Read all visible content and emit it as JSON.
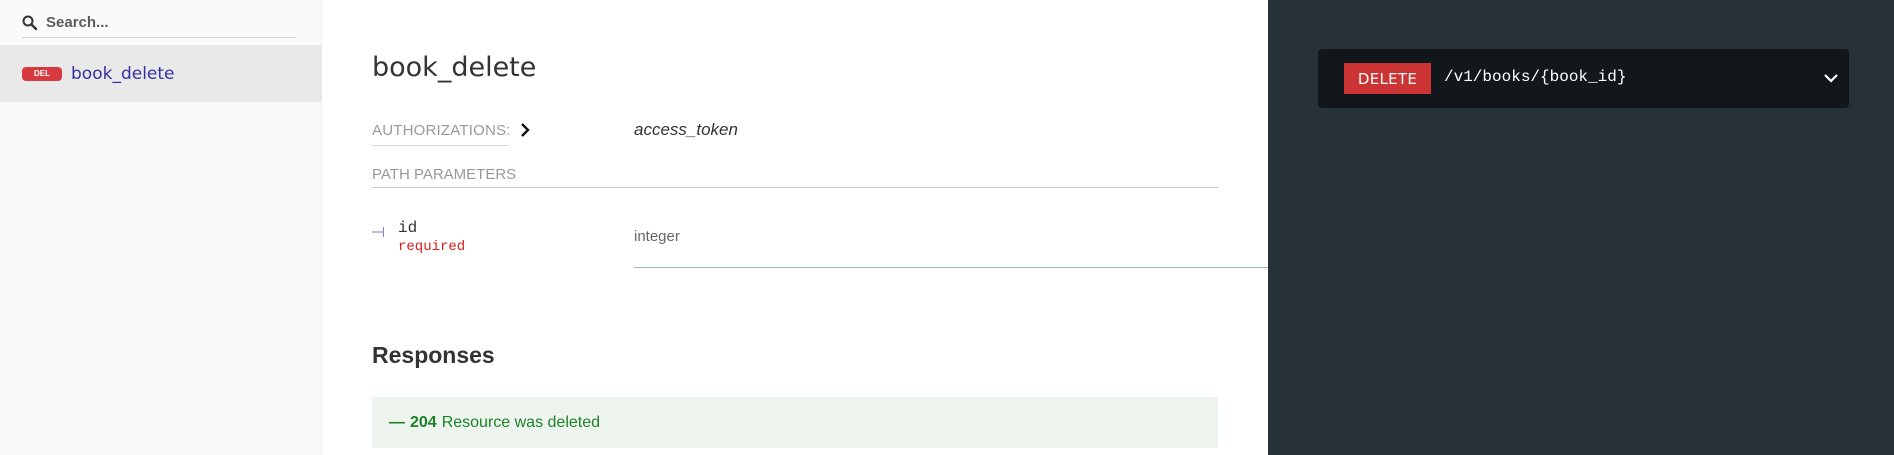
{
  "sidebar": {
    "search": {
      "placeholder": "Search..."
    },
    "items": [
      {
        "badge": "DEL",
        "label": "book_delete"
      }
    ]
  },
  "main": {
    "title": "book_delete",
    "authorizations": {
      "label": "AUTHORIZATIONS:",
      "value": "access_token"
    },
    "path_parameters": {
      "heading": "PATH PARAMETERS",
      "params": [
        {
          "name": "id",
          "required": "required",
          "type": "integer"
        }
      ]
    },
    "responses": {
      "title": "Responses",
      "items": [
        {
          "dash": "—",
          "code": "204",
          "description": "Resource was deleted"
        }
      ]
    }
  },
  "right_panel": {
    "method": "DELETE",
    "path": "/v1/books/{book_id}"
  },
  "colors": {
    "delete_badge": "#cc3333",
    "sidebar_label": "#32329f",
    "success_text": "#1d8127",
    "required_text": "#d41f1c",
    "right_panel_bg": "#263238"
  }
}
